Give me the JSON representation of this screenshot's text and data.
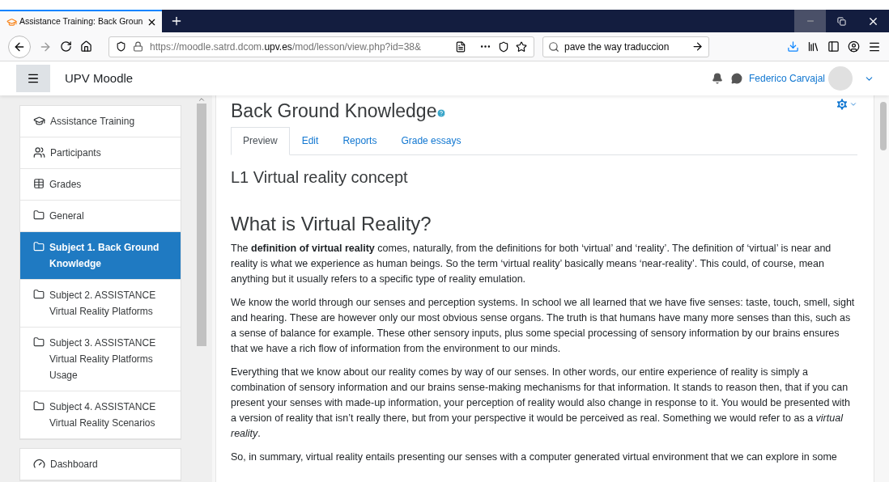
{
  "browser": {
    "tab_title": "Assistance Training: Back Groun",
    "url": [
      {
        "text": "https://moodle.satrd.dcom.",
        "strong": false
      },
      {
        "text": "upv.es",
        "strong": true
      },
      {
        "text": "/mod/lesson/view.php?id=38&",
        "strong": false
      }
    ],
    "search_value": "pave the way traduccion"
  },
  "navbar": {
    "site_name": "UPV Moodle",
    "user_name": "Federico Carvajal"
  },
  "sidebar": {
    "items": [
      {
        "kind": "course",
        "label": "Assistance Training",
        "selected": false
      },
      {
        "kind": "participants",
        "label": "Participants",
        "selected": false
      },
      {
        "kind": "grades",
        "label": "Grades",
        "selected": false
      },
      {
        "kind": "section",
        "label": "General",
        "selected": false
      },
      {
        "kind": "section",
        "label": "Subject 1. Back Ground Knowledge",
        "selected": true
      },
      {
        "kind": "section",
        "label": "Subject 2. ASSISTANCE Virtual Reality Platforms",
        "selected": false
      },
      {
        "kind": "section",
        "label": "Subject 3. ASSISTANCE Virtual Reality Platforms Usage",
        "selected": false
      },
      {
        "kind": "section",
        "label": "Subject 4. ASSISTANCE Virtual Reality Scenarios",
        "selected": false
      }
    ],
    "second_items": [
      {
        "kind": "dashboard",
        "label": "Dashboard",
        "selected": false
      }
    ]
  },
  "page": {
    "title": "Back Ground Knowledge",
    "tabs": [
      {
        "label": "Preview",
        "selected": true
      },
      {
        "label": "Edit",
        "selected": false
      },
      {
        "label": "Reports",
        "selected": false
      },
      {
        "label": "Grade essays",
        "selected": false
      }
    ],
    "lesson_title": "L1 Virtual reality concept",
    "heading": "What is Virtual Reality?",
    "paragraphs": [
      "The **definition of virtual reality** comes, naturally, from the definitions for both ‘virtual’ and ‘reality’. The definition of ‘virtual’ is near and reality is what we experience as human beings. So the term ‘virtual reality’ basically means ‘near-reality’. This could, of course, mean anything but it usually refers to a specific type of reality emulation.",
      "We know the world through our senses and perception systems. In school we all learned that we have five senses: taste, touch, smell, sight and hearing. These are however only our most obvious sense organs. The truth is that humans have many more senses than this, such as a sense of balance for example. These other sensory inputs, plus some special processing of sensory information by our brains ensures that we have a rich flow of information from the environment to our minds.",
      "Everything that we know about our reality comes by way of our senses. In other words, our entire experience of reality is simply a combination of sensory information and our brains sense-making mechanisms for that information. It stands to reason then, that if you can present your senses with made-up information, your perception of reality would also change in response to it. You would be presented with a version of reality that isn’t really there, but from your perspective it would be perceived as real. Something we would refer to as a *virtual reality*.",
      "So, in summary, virtual reality entails presenting our senses with a computer generated virtual environment that we can explore in some"
    ]
  }
}
